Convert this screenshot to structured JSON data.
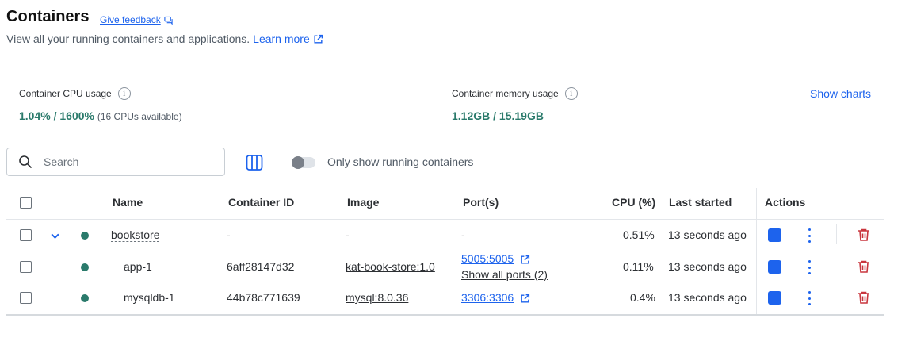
{
  "header": {
    "title": "Containers",
    "feedback_label": "Give feedback",
    "subtitle": "View all your running containers and applications.",
    "learn_more": "Learn more"
  },
  "stats": {
    "cpu_label": "Container CPU usage",
    "cpu_value": "1.04% / 1600%",
    "cpu_note": "(16 CPUs available)",
    "mem_label": "Container memory usage",
    "mem_value": "1.12GB / 15.19GB",
    "show_charts": "Show charts"
  },
  "toolbar": {
    "search_placeholder": "Search",
    "running_toggle_label": "Only show running containers"
  },
  "table": {
    "headers": {
      "name": "Name",
      "id": "Container ID",
      "image": "Image",
      "ports": "Port(s)",
      "cpu": "CPU (%)",
      "last": "Last started",
      "actions": "Actions"
    },
    "rows": [
      {
        "name": "bookstore",
        "id": "-",
        "image": "-",
        "port": "-",
        "port_extra": "",
        "cpu": "0.51%",
        "last": "13 seconds ago"
      },
      {
        "name": "app-1",
        "id": "6aff28147d32",
        "image": "kat-book-store:1.0",
        "port": "5005:5005",
        "port_extra": "Show all ports (2)",
        "cpu": "0.11%",
        "last": "13 seconds ago"
      },
      {
        "name": "mysqldb-1",
        "id": "44b78c771639",
        "image": "mysql:8.0.36",
        "port": "3306:3306",
        "port_extra": "",
        "cpu": "0.4%",
        "last": "13 seconds ago"
      }
    ]
  },
  "colors": {
    "accent": "#1d63ed",
    "running": "#2a7a6b",
    "delete": "#c9363e"
  }
}
